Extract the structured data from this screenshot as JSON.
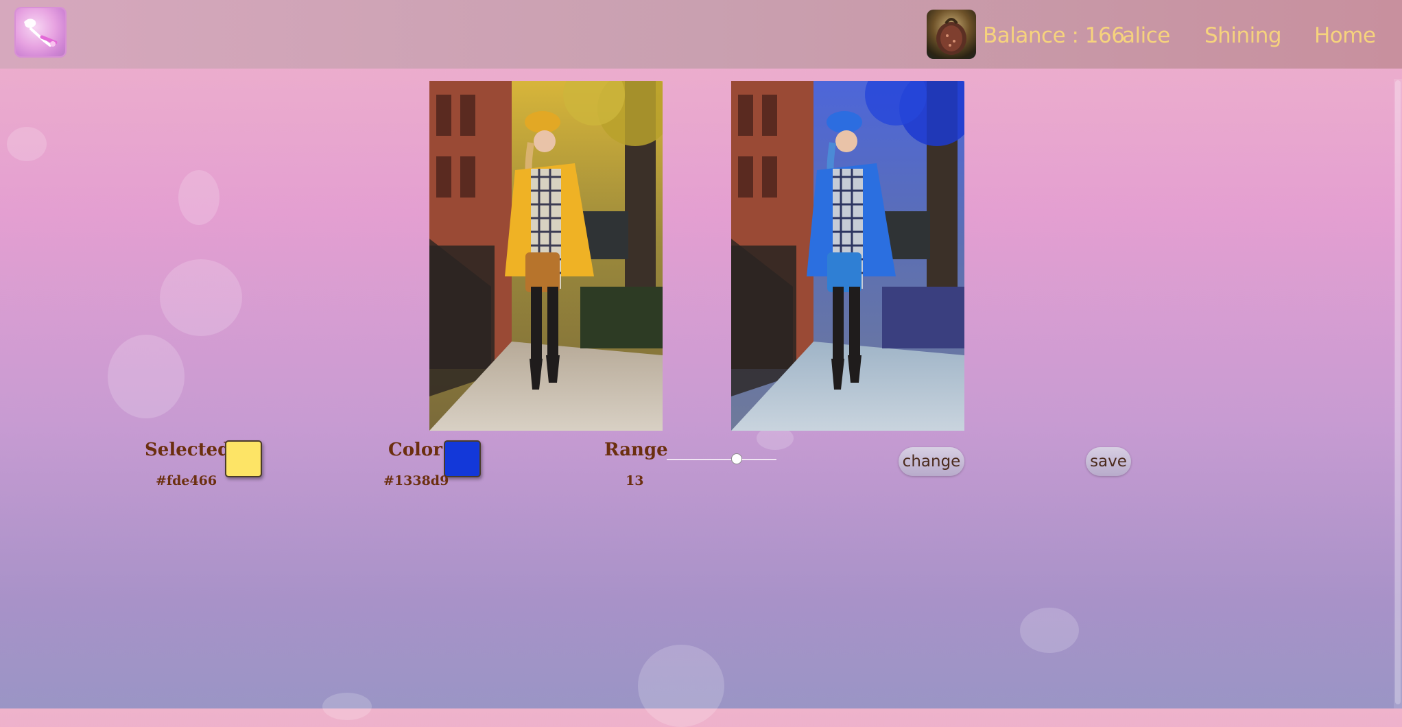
{
  "header": {
    "logo": "brush-logo",
    "avatar": "profile-avatar",
    "balance_text": "Balance : 166",
    "username": "alice",
    "nav_shining": "Shining",
    "nav_home": "Home"
  },
  "images": {
    "original": "original-photo",
    "result": "recolored-photo"
  },
  "controls": {
    "selected": {
      "label": "Selected",
      "hex": "#fde466",
      "color": "#fde466"
    },
    "target": {
      "label": "Color",
      "hex": "#1338d9",
      "color": "#1338d9"
    },
    "range": {
      "label": "Range",
      "value": "13",
      "min": 0,
      "max": 20,
      "current": 13
    },
    "change_label": "change",
    "save_label": "save"
  },
  "colors": {
    "nav_text": "#f6d37d",
    "control_text": "#6b2f0f"
  }
}
